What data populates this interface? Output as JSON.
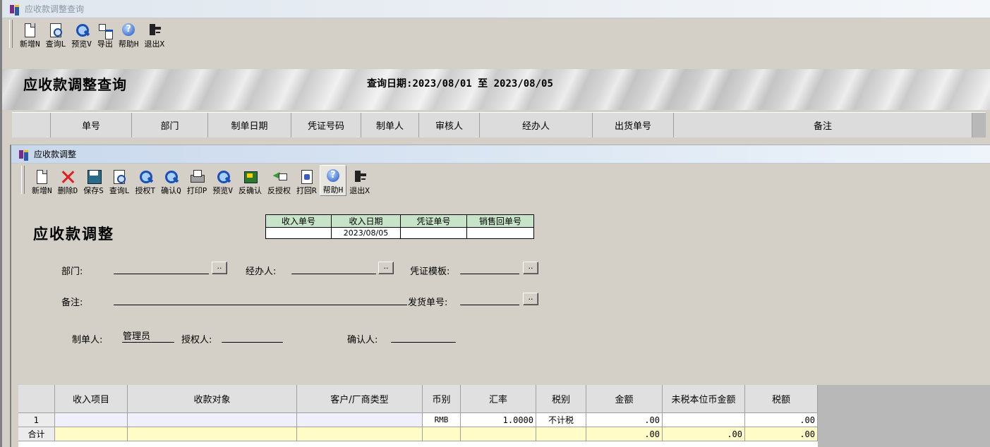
{
  "outer": {
    "title": "应收款调整查询",
    "toolbar": [
      "新增N",
      "查询L",
      "预览V",
      "导出",
      "帮助H",
      "退出X"
    ],
    "banner_title": "应收款调整查询",
    "query_date_label": "查询日期:",
    "date_from": "2023/08/01",
    "date_sep": "至",
    "date_to": "2023/08/05",
    "columns": [
      "单号",
      "部门",
      "制单日期",
      "凭证号码",
      "制单人",
      "审核人",
      "经办人",
      "出货单号",
      "备注"
    ]
  },
  "inner": {
    "title": "应收款调整",
    "toolbar": [
      "新增N",
      "删除D",
      "保存S",
      "查询L",
      "授权T",
      "确认Q",
      "打印P",
      "预览V",
      "反确认",
      "反授权",
      "打回R",
      "帮助H",
      "退出X"
    ],
    "form_title": "应收款调整",
    "info_headers": [
      "收入单号",
      "收入日期",
      "凭证单号",
      "销售回单号"
    ],
    "info_values": [
      "",
      "2023/08/05",
      "",
      ""
    ],
    "fields": {
      "dept_label": "部门:",
      "dept_value": "",
      "handler_label": "经办人:",
      "handler_value": "",
      "voucher_tpl_label": "凭证模板:",
      "voucher_tpl_value": "",
      "remark_label": "备注:",
      "remark_value": "",
      "ship_no_label": "发货单号:",
      "ship_no_value": "",
      "maker_label": "制单人:",
      "maker_value": "管理员",
      "auth_label": "授权人:",
      "auth_value": "",
      "confirm_label": "确认人:",
      "confirm_value": ""
    },
    "ellipsis": "..",
    "grid": {
      "headers": [
        "",
        "收入项目",
        "收款对象",
        "客户/厂商类型",
        "币别",
        "汇率",
        "税别",
        "金额",
        "未税本位币金额",
        "税额"
      ],
      "rows": [
        [
          "1",
          "",
          "",
          "",
          "RMB",
          "1.0000",
          "不计税",
          ".00",
          "",
          ".00"
        ]
      ],
      "total": [
        "合计",
        "",
        "",
        "",
        "",
        "",
        "",
        ".00",
        ".00",
        ".00"
      ]
    }
  }
}
